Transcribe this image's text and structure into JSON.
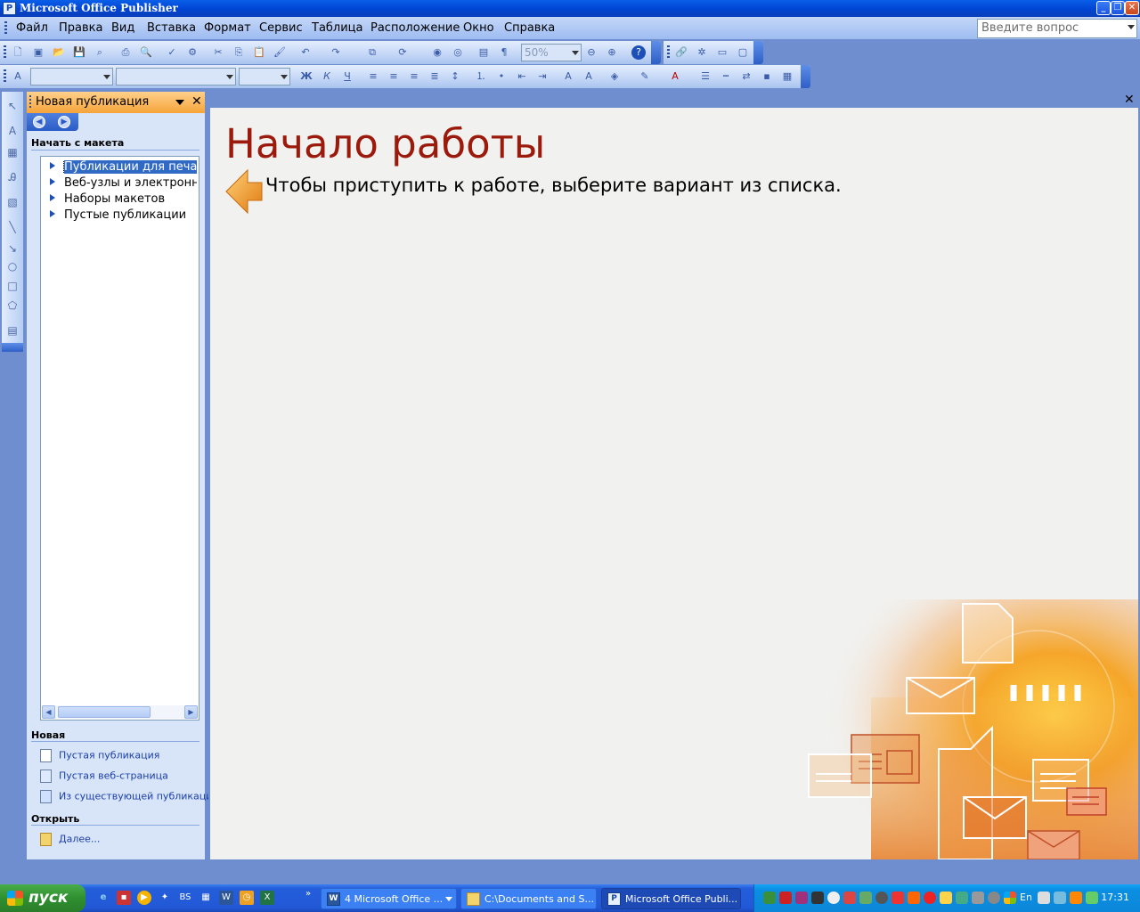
{
  "window": {
    "title": "Microsoft Office Publisher",
    "app_icon": "publisher-icon",
    "controls": [
      "minimize-icon",
      "restore-icon",
      "close-icon"
    ]
  },
  "menubar": {
    "items": [
      "Файл",
      "Правка",
      "Вид",
      "Вставка",
      "Формат",
      "Сервис",
      "Таблица",
      "Расположение",
      "Окно",
      "Справка"
    ],
    "ask_placeholder": "Введите вопрос"
  },
  "toolbar_standard": {
    "zoom": "50%",
    "icons": [
      "new-icon",
      "publish-icon",
      "open-icon",
      "save-icon",
      "search-icon",
      "print-icon",
      "print-preview-icon",
      "spelling-icon",
      "research-icon",
      "cut-icon",
      "copy-icon",
      "paste-icon",
      "format-painter-icon",
      "undo-icon",
      "redo-icon",
      "arrange-icon",
      "rotate-icon",
      "zoom-in-icon",
      "zoom-out-icon",
      "columns-icon",
      "pilcrow-icon",
      "zoom-out-magnifier-icon",
      "zoom-in-magnifier-icon",
      "help-icon"
    ]
  },
  "toolbar_web": {
    "icons": [
      "hyperlink-icon",
      "web-options-icon",
      "web-preview-icon",
      "web-form-icon"
    ]
  },
  "toolbar_format": {
    "style": "",
    "font": "",
    "size": "",
    "bold": "Ж",
    "italic": "К",
    "underline": "Ч"
  },
  "object_toolbar": {
    "icons": [
      "pointer-icon",
      "text-box-icon",
      "table-icon",
      "wordart-icon",
      "picture-icon",
      "line-icon",
      "arrow-icon",
      "oval-icon",
      "rectangle-icon",
      "autoshapes-icon",
      "design-gallery-icon"
    ]
  },
  "taskpane": {
    "title": "Новая публикация",
    "section_start": "Начать с макета",
    "tree": [
      "Публикации для печати",
      "Веб-узлы и электронная почта",
      "Наборы макетов",
      "Пустые публикации"
    ],
    "selected_index": 0,
    "section_new": "Новая",
    "new_links": [
      "Пустая публикация",
      "Пустая веб-страница",
      "Из существующей публикации..."
    ],
    "section_open": "Открыть",
    "open_link": "Далее..."
  },
  "document": {
    "heading": "Начало работы",
    "instruction": "Чтобы приступить к работе, выберите вариант из списка."
  },
  "taskbar": {
    "start_label": "пуск",
    "tasks": [
      {
        "label": "4 Microsoft Office ...",
        "icon": "word-icon",
        "active": false
      },
      {
        "label": "C:\\Documents and S...",
        "icon": "folder-icon",
        "active": false
      },
      {
        "label": "Microsoft Office Publi...",
        "icon": "publisher-icon",
        "active": true
      }
    ],
    "language": "En",
    "time": "17:31"
  },
  "colors": {
    "title_bar": "#0054e3",
    "heading": "#9c1a0c",
    "taskpane_header": "#f5a43a",
    "selection": "#316ac5"
  }
}
